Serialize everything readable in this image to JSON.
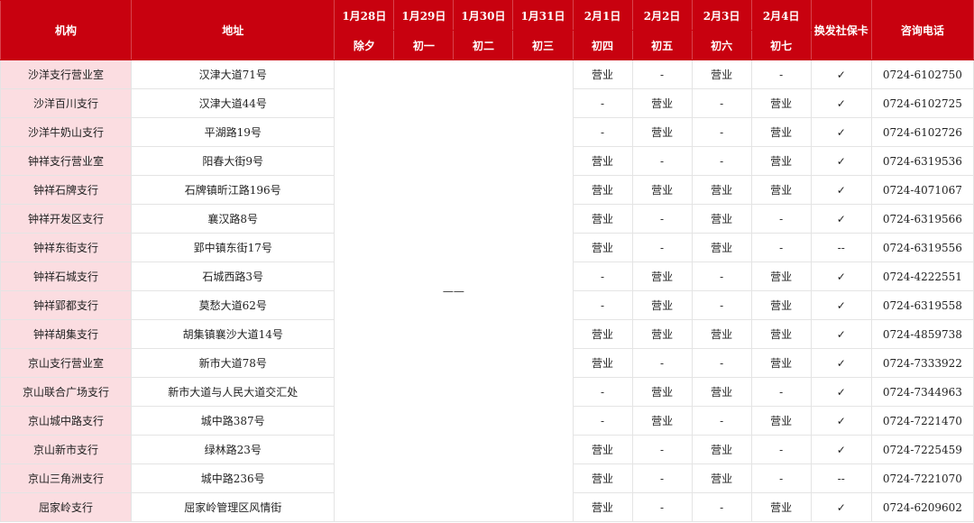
{
  "headers": {
    "org": "机构",
    "addr": "地址",
    "card": "换发社保卡",
    "phone": "咨询电话",
    "dates": [
      {
        "date": "1月28日",
        "day": "除夕"
      },
      {
        "date": "1月29日",
        "day": "初一"
      },
      {
        "date": "1月30日",
        "day": "初二"
      },
      {
        "date": "1月31日",
        "day": "初三"
      },
      {
        "date": "2月1日",
        "day": "初四"
      },
      {
        "date": "2月2日",
        "day": "初五"
      },
      {
        "date": "2月3日",
        "day": "初六"
      },
      {
        "date": "2月4日",
        "day": "初七"
      }
    ]
  },
  "closed_mark": "——",
  "rows": [
    {
      "org": "沙洋支行营业室",
      "addr": "汉津大道71号",
      "days": [
        "营业",
        "-",
        "营业",
        "-"
      ],
      "card": "✓",
      "phone": "0724-6102750"
    },
    {
      "org": "沙洋百川支行",
      "addr": "汉津大道44号",
      "days": [
        "-",
        "营业",
        "-",
        "营业"
      ],
      "card": "✓",
      "phone": "0724-6102725"
    },
    {
      "org": "沙洋牛奶山支行",
      "addr": "平湖路19号",
      "days": [
        "-",
        "营业",
        "-",
        "营业"
      ],
      "card": "✓",
      "phone": "0724-6102726"
    },
    {
      "org": "钟祥支行营业室",
      "addr": "阳春大街9号",
      "days": [
        "营业",
        "-",
        "-",
        "营业"
      ],
      "card": "✓",
      "phone": "0724-6319536"
    },
    {
      "org": "钟祥石牌支行",
      "addr": "石牌镇昕江路196号",
      "days": [
        "营业",
        "营业",
        "营业",
        "营业"
      ],
      "card": "✓",
      "phone": "0724-4071067"
    },
    {
      "org": "钟祥开发区支行",
      "addr": "襄汉路8号",
      "days": [
        "营业",
        "-",
        "营业",
        "-"
      ],
      "card": "✓",
      "phone": "0724-6319566"
    },
    {
      "org": "钟祥东街支行",
      "addr": "郢中镇东街17号",
      "days": [
        "营业",
        "-",
        "营业",
        "-"
      ],
      "card": "--",
      "phone": "0724-6319556"
    },
    {
      "org": "钟祥石城支行",
      "addr": "石城西路3号",
      "days": [
        "-",
        "营业",
        "-",
        "营业"
      ],
      "card": "✓",
      "phone": "0724-4222551"
    },
    {
      "org": "钟祥郢都支行",
      "addr": "莫愁大道62号",
      "days": [
        "-",
        "营业",
        "-",
        "营业"
      ],
      "card": "✓",
      "phone": "0724-6319558"
    },
    {
      "org": "钟祥胡集支行",
      "addr": "胡集镇襄沙大道14号",
      "days": [
        "营业",
        "营业",
        "营业",
        "营业"
      ],
      "card": "✓",
      "phone": "0724-4859738"
    },
    {
      "org": "京山支行营业室",
      "addr": "新市大道78号",
      "days": [
        "营业",
        "-",
        "-",
        "营业"
      ],
      "card": "✓",
      "phone": "0724-7333922"
    },
    {
      "org": "京山联合广场支行",
      "addr": "新市大道与人民大道交汇处",
      "days": [
        "-",
        "营业",
        "营业",
        "-"
      ],
      "card": "✓",
      "phone": "0724-7344963"
    },
    {
      "org": "京山城中路支行",
      "addr": "城中路387号",
      "days": [
        "-",
        "营业",
        "-",
        "营业"
      ],
      "card": "✓",
      "phone": "0724-7221470"
    },
    {
      "org": "京山新市支行",
      "addr": "绿林路23号",
      "days": [
        "营业",
        "-",
        "营业",
        "-"
      ],
      "card": "✓",
      "phone": "0724-7225459"
    },
    {
      "org": "京山三角洲支行",
      "addr": "城中路236号",
      "days": [
        "营业",
        "-",
        "营业",
        "-"
      ],
      "card": "--",
      "phone": "0724-7221070"
    },
    {
      "org": "屈家岭支行",
      "addr": "屈家岭管理区风情街",
      "days": [
        "营业",
        "-",
        "-",
        "营业"
      ],
      "card": "✓",
      "phone": "0724-6209602"
    }
  ]
}
